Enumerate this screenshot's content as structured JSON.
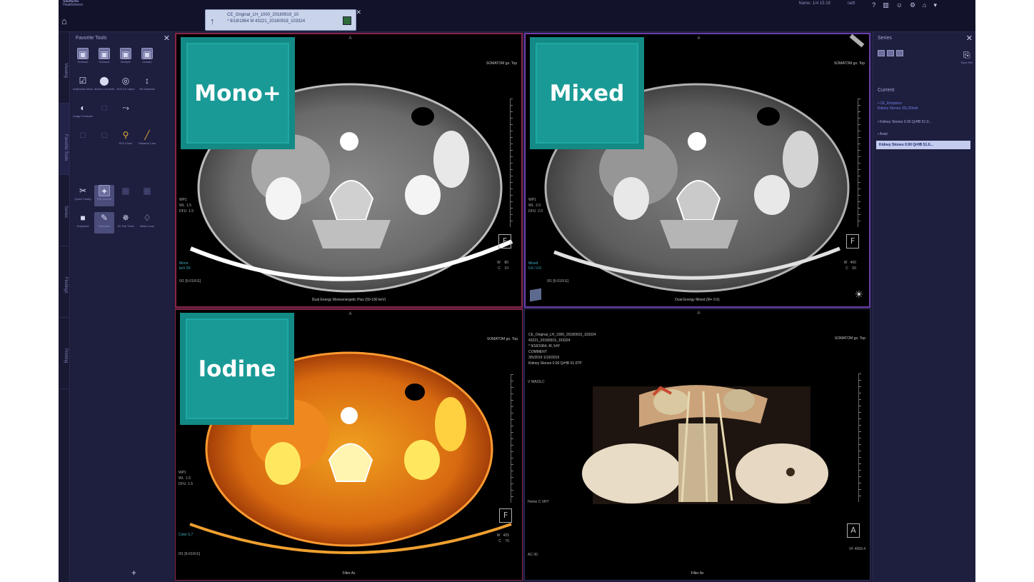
{
  "topbar": {
    "brand_line1": "SIEMENS",
    "brand_line2": "Healthineers",
    "series_tab": {
      "line1": "CE_Original_LH_1000_20180919_10",
      "line2": "* 9/18/1964 M 43221_20180919_103324"
    },
    "right_text": "Name: 1/4 15:18",
    "user": "radt"
  },
  "vtabs": [
    "Viewing",
    "Favorite Tools",
    "Series",
    "Findings",
    "Printing"
  ],
  "tools": {
    "title": "Favorite Tools",
    "items": [
      {
        "label": "Subtract",
        "icon": "subtract-icon"
      },
      {
        "label": "Subtract",
        "icon": "subtract-icon"
      },
      {
        "label": "Multiple",
        "icon": "multiple-icon"
      },
      {
        "label": "Classic",
        "icon": "classic-icon"
      },
      {
        "label": "Arithmetic Mean",
        "icon": "arithmetic-mean-icon"
      },
      {
        "label": "Motion Correction",
        "icon": "motion-correction-icon"
      },
      {
        "label": "ROI 3 D value",
        "icon": "roi-3d-icon"
      },
      {
        "label": "3D Distance",
        "icon": "distance-3d-icon"
      },
      {
        "label": "Image Contrast",
        "icon": "image-contrast-icon"
      },
      {
        "label": "",
        "icon": "disabled-tool-icon"
      },
      {
        "label": "",
        "icon": "disabled-tool-icon"
      },
      {
        "label": "ROI Circle",
        "icon": "roi-circle-icon"
      },
      {
        "label": "Distance Line",
        "icon": "distance-line-icon"
      },
      {
        "label": "Quick Config",
        "icon": "quick-config-icon"
      },
      {
        "label": "Full Screen",
        "icon": "full-screen-icon"
      },
      {
        "label": "",
        "icon": "disabled-tool-icon"
      },
      {
        "label": "",
        "icon": "disabled-tool-icon"
      },
      {
        "label": "Snapshot",
        "icon": "snapshot-icon"
      },
      {
        "label": "Selection",
        "icon": "selection-icon"
      },
      {
        "label": "2D Full Thick",
        "icon": "full-thick-icon"
      },
      {
        "label": "Make Loop",
        "icon": "make-loop-icon"
      }
    ],
    "plus": "+"
  },
  "viewports": {
    "mono": {
      "badge": "Mono+",
      "top_right": "SOMATOM go. Top",
      "bottom_label": "Dual Energy Monoenergetic Plus (50-190 keV)",
      "left_info": "WP1\nWL  1.5\nDFU  1.5",
      "accent_info": "Mono\nkeV 50",
      "left_bottom": "0/1 [6-01/9 E]",
      "right_info": "W    80\nC    10",
      "orient": "F"
    },
    "mixed": {
      "badge": "Mixed",
      "top_right": "SOMATOM go. Top",
      "bottom_label": "Dual Energy Mixed (M+ 0.6)",
      "left_info": "WP1\nWL  2.0\nDFU  2.0",
      "accent_info": "Mixed\n0.6 / 0.6",
      "left_bottom": "0/1 [6-01/9 E]",
      "right_info": "W   400\nC    50",
      "orient": "F"
    },
    "iodine": {
      "badge": "Iodine",
      "top_right": "SOMATOM go. Top",
      "bottom_label": "Filter Ax",
      "left_info": "WP1\nWL  1.5\nDFU  1.5",
      "accent_info": "Color 5.7",
      "left_bottom": "0/1 [6-01/9 E]",
      "right_info": "W   425\nC    75",
      "orient": "F"
    },
    "vrt": {
      "top_right": "SOMATOM go. Top",
      "info": "CE_Original_LH_1000_20180919_103324\n43221_20180919_103324\n* 9/18/1964, M, 54Y\nCOMMENT\n3/5/2019 1/19/2019\nKidney Stones 0.90 QrHB 51.0TP",
      "info2": "V WA/SLC",
      "mid_left": "Home C VRT",
      "bottom_left": "AC 00",
      "bottom_right": "VF 4059.4",
      "bottom_label": "Filter Ax",
      "orient": "A"
    }
  },
  "rpanel": {
    "title": "Series",
    "save_label": "Save Ref",
    "current": "Current",
    "tree": [
      "• CE_Kimptons",
      "  Kidney Stones 15L/20mA",
      "  • Kidney Stones 0.90 QrHB 51.0...",
      "    • Axial",
      "Kidney Stones 0.90 QrHB 51.0..."
    ]
  },
  "colors": {
    "badge": "#1a9a96",
    "frame_red": "#8b2447",
    "frame_purple": "#6b3ca8",
    "panel": "#1e1e3e",
    "selected_row": "#c3cbee"
  }
}
